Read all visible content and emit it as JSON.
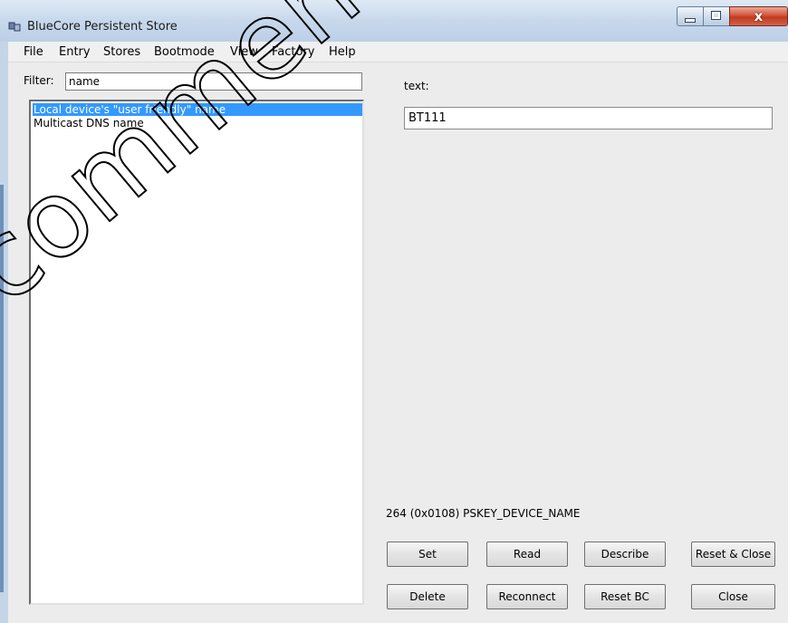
{
  "window": {
    "title": "BlueCore Persistent Store",
    "close_glyph": "x"
  },
  "menu": [
    "File",
    "Entry",
    "Stores",
    "Bootmode",
    "View",
    "Factory",
    "Help"
  ],
  "filter": {
    "label": "Filter:",
    "value": "name"
  },
  "list": {
    "items": [
      {
        "label": "Local device's \"user friendly\" name",
        "selected": true
      },
      {
        "label": "Multicast DNS name",
        "selected": false
      }
    ]
  },
  "entry": {
    "type_label": "text:",
    "value": "BT111",
    "key_info": "264 (0x0108) PSKEY_DEVICE_NAME"
  },
  "buttons": {
    "set": "Set",
    "read": "Read",
    "describe": "Describe",
    "reset_close": "Reset & Close",
    "delete": "Delete",
    "reconnect": "Reconnect",
    "reset_bc": "Reset BC",
    "close": "Close"
  },
  "watermark": {
    "text": "commende"
  },
  "colors": {
    "selection": "#3399ff",
    "close_button": "#c94a2e",
    "titlebar": "#c7d8ec"
  }
}
